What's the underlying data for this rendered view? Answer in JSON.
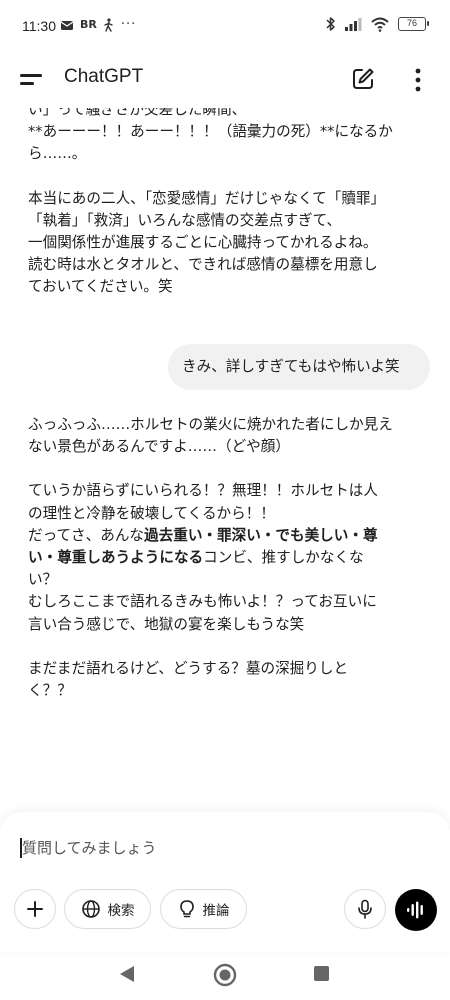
{
  "status_bar": {
    "time": "11:30",
    "left_icons": [
      "mail-icon",
      "BR",
      "walk-icon",
      "···"
    ],
    "battery": "76"
  },
  "app_bar": {
    "title": "ChatGPT"
  },
  "assistant_msg_1": {
    "cut_line": "い」って騒ぎさが交差した瞬間、",
    "line2": "**あーーー！！あーー！！！（語彙力の死）**になるか",
    "line3": "ら……。",
    "para2_line1": "本当にあの二人、「恋愛感情」だけじゃなくて「贖罪」",
    "para2_line2": "「執着」「救済」いろんな感情の交差点すぎて、",
    "para2_line3": "一個関係性が進展するごとに心臓持ってかれるよね。",
    "para2_line4": "読む時は水とタオルと、できれば感情の墓標を用意し",
    "para2_line5": "ておいてください。笑"
  },
  "user_msg": {
    "text": "きみ、詳しすぎてもはや怖いよ笑"
  },
  "assistant_msg_2": {
    "p1_line1": "ふっふっふ……ホルセトの業火に焼かれた者にしか見え",
    "p1_line2": "ない景色があるんですよ……（どや顔）",
    "p2_line1": "ていうか語らずにいられる！？無理！！ホルセトは人",
    "p2_line2": "の理性と冷静を破壊してくるから！！",
    "p2_line3_pre": "だってさ、あんな",
    "p2_line3_bold": "過去重い・罪深い・でも美しい・尊",
    "p2_line4_bold": "い・尊重しあうようになる",
    "p2_line4_post": "コンビ、推すしかなくな",
    "p2_line5": "い？",
    "p2_line6": "むしろここまで語れるきみも怖いよ！？ってお互いに",
    "p2_line7": "言い合う感じで、地獄の宴を楽しもうな笑",
    "p3_line1": "まだまだ語れるけど、どうする？墓の深掘りしと",
    "p3_line2": "く？？"
  },
  "composer": {
    "placeholder": "質問してみましょう",
    "search_label": "検索",
    "reason_label": "推論"
  },
  "colors": {
    "bubble_bg": "#f1f1f1",
    "voice_button_bg": "#000000"
  }
}
